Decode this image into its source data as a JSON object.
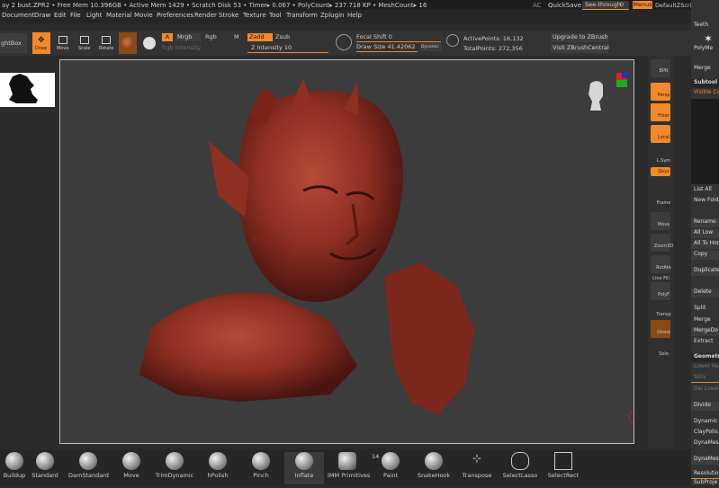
{
  "status": {
    "text": "ay 2 bust.ZPR2  • Free Mem 10.396GB • Active Mem 1429 • Scratch Disk 53 •  Timer▸ 0.067 • PolyCount▸ 237.718 KP • MeshCount▸ 16",
    "ac": "AC",
    "quicksave": "QuickSave",
    "seethrough": "See-through",
    "seethrough_value": "0",
    "menus": "Menus",
    "script": "DefaultZScript"
  },
  "menu": [
    "Document",
    "Draw",
    "Edit",
    "File",
    "Light",
    "Material",
    "Movie",
    "Preferences",
    "Render",
    "Stroke",
    "Texture",
    "Tool",
    "Transform",
    "Zplugin",
    "Help"
  ],
  "toolbar": {
    "lightbox": "ghtBox",
    "draw": "Draw",
    "move": "Move",
    "scale": "Scale",
    "rotate": "Rotate",
    "a": "A",
    "mrgb": "Mrgb",
    "rgb": "Rgb",
    "m": "M",
    "zadd": "Zadd",
    "zsub": "Zsub",
    "rgb_intensity": "Rgb Intensity",
    "z_intensity": "Z Intensity",
    "z_intensity_value": "10",
    "focal_shift": "Focal Shift",
    "focal_shift_value": "0",
    "draw_size": "Draw Size",
    "draw_size_value": "41.42062",
    "dynamic": "Dynamic",
    "active_points": "ActivePoints: 16,132",
    "total_points": "TotalPoints: 272,356",
    "upgrade": "Upgrade to ZBrush",
    "visit": "Visit ZBrushCentral"
  },
  "shelf": {
    "bpr": "BPR",
    "persp": "Persp",
    "floor": "Floor",
    "local": "Local",
    "lsym": "L.Sym",
    "xyz": "Qxyz",
    "frame": "Frame",
    "move": "Move",
    "zoom3d": "Zoom3D",
    "rotate": "RotAte",
    "line_fill": "Line Fill",
    "polyf": "PolyF",
    "transp": "Transp",
    "ghost": "Ghost",
    "solo": "Solo"
  },
  "tray": {
    "teeth": "Teeth",
    "polymesh": "PolyMe",
    "merge": "Merge",
    "subtool": "Subtool",
    "visible_count": "Visible Co",
    "list_all": "List All",
    "new_folder": "New Folde",
    "rename": "Rename",
    "all_low": "All Low",
    "all_to_home": "All To Hor",
    "copy": "Copy",
    "duplicate": "Duplicate",
    "delete": "Delete",
    "split": "Split",
    "merge2": "Merge",
    "merge_down": "MergeDo",
    "extract": "Extract",
    "geometry": "Geometr",
    "lower_res": "Lower Re",
    "sdiv": "SDiv",
    "del_lower": "Del Lowe",
    "divide": "Divide",
    "dynamic": "Dynamic",
    "claypolish": "ClayPolis",
    "dynamesh": "DynaMes",
    "dynamesh2": "DynaMesh",
    "resolution": "Resolution",
    "subproj": "SubProje"
  },
  "brushes": [
    "Buildup",
    "Standard",
    "DamStandard",
    "Move",
    "TrimDynamic",
    "hPolish",
    "Pinch",
    "Inflate",
    "IMM Primitives",
    "Paint",
    "SnakeHook",
    "Transpose",
    "SelectLasso",
    "SelectRect"
  ],
  "imm_count": "14",
  "colors": {
    "accent": "#f3892b",
    "clay": "#8e2f22"
  }
}
